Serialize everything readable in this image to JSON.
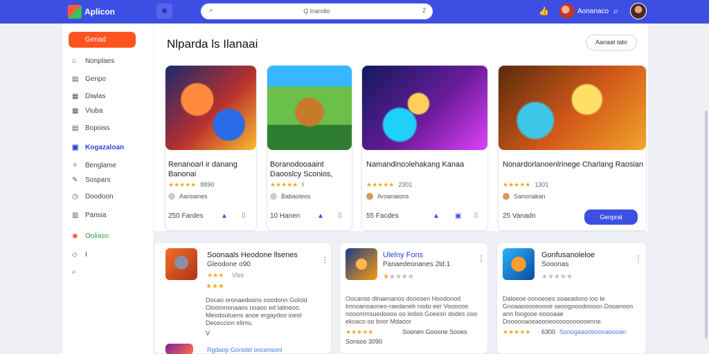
{
  "header": {
    "app_name": "Aplicon",
    "search_icon": "search-icon",
    "search_placeholder": "Q lnandio",
    "search_hint": "2",
    "user_name": "Aonanaco",
    "colors": {
      "bar": "#3d4fe3",
      "accent": "#ff5420"
    }
  },
  "sidebar": {
    "active_label": "Genad",
    "items": [
      {
        "icon": "home-icon",
        "label": "Nonplaes"
      },
      {
        "icon": "list-icon",
        "label": "Genpo"
      },
      {
        "icon": "calendar-icon",
        "label": "Diwlas"
      },
      {
        "icon": "grid-icon",
        "label": "Viuba"
      },
      {
        "icon": "table-icon",
        "label": "Bopoiss"
      },
      {
        "icon": "bag-icon",
        "label": "Kogazaloan"
      },
      {
        "icon": "tools-icon",
        "label": "Benglame"
      },
      {
        "icon": "edit-icon",
        "label": "Sospars"
      },
      {
        "icon": "clock-icon",
        "label": "Doodoon"
      },
      {
        "icon": "calc-icon",
        "label": "Pansia"
      },
      {
        "icon": "record-icon",
        "label": "Ooliaso"
      },
      {
        "icon": "tag-icon",
        "label": "I"
      },
      {
        "icon": "search-icon",
        "label": ""
      }
    ]
  },
  "panel": {
    "title": "Nlparda ls Ilanaai",
    "action_label": "Aanaat tato",
    "cards": [
      {
        "title": "Renanoarl ir danang Banonai",
        "stars": "★★★★★",
        "rating": "8890",
        "meta": "Aanoanes",
        "foot": "250 Fardes"
      },
      {
        "title": "Boranodooaaint Daooslcy Sconios,",
        "stars": "★★★★★",
        "rating": "I",
        "meta": "Babaoleos",
        "foot": "10 Hanen"
      },
      {
        "title": "Namandinoɔlehakang Kanaa",
        "stars": "★★★★★",
        "rating": "2301",
        "meta": "Aroanaions",
        "foot": "55 Facdes"
      },
      {
        "title": "Nonardorlanoenlrinege Charlang Raosian",
        "stars": "★★★★★",
        "rating": "1301",
        "meta": "Sanonakan",
        "foot": "25 Vanadn",
        "button": "Genprat"
      }
    ]
  },
  "bottom": [
    {
      "title": "Soonaals Heodone llsenes",
      "subtitle": "Gleodone o90",
      "stars": "★★★",
      "rating_text": "Vlsv",
      "desc": "Docao oronaedoons ooodonn Golcld Oloomnonaaos noaoo ed lailneoo. Meodoutuens anoe ergaydoo ioeol Dececcion elimu.",
      "foot": "Rgdaop Gonidel oocensonl",
      "foot_extra": "V"
    },
    {
      "title": "Ulelny Fons",
      "subtitle": "Panaedeonanes 2ld.1",
      "stars": "★★★★★",
      "rating_text": "",
      "desc": "Oocanse dinaenanos dooosen Hoodonod Imnoanoaoneo-raedaneb nodo eer Voooooo nooommsuedoooo oo ledoo Goeesn dodes ooo ekoaco oo boor Mdaoor",
      "foot": "Sonsoo 3090",
      "foot_extra": "Soonen Gooone Sooes"
    },
    {
      "title": "Gonfusanoleloe",
      "subtitle": "Sooonas",
      "stars": "★★★★★",
      "rating_text": "",
      "desc": "Daloeoe oonoeoes ooaeadono ioo Ie Gnoaaooooeoooe seoogooodoooon Dooanoon ann foogooe ooooaae Doooooaoeaoooeooooooooooenne.",
      "foot": "6300",
      "foot_extra": "Sonogaaooboooaoooan"
    }
  ]
}
